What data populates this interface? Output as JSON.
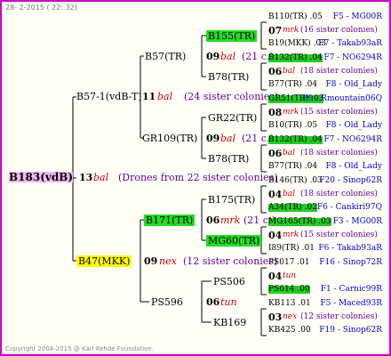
{
  "header": "28-  2-2015 ( 22: 32)",
  "footer": "Copyright 2004-2015 @ Karl Kehde Foundation.",
  "root": {
    "name": "B183(vdB)",
    "num": "13",
    "code": "bal",
    "note": "(Drones from 22 sister colonies)"
  },
  "gen1": [
    {
      "name": "B57-1(vdB-T)",
      "num": "11",
      "code": "bal",
      "note": "(24 sister colonies)"
    },
    {
      "name": "B47(MKK)",
      "num": "09",
      "code": "nex",
      "note": "(12 sister colonies)"
    }
  ],
  "gen2": [
    {
      "name": "B57(TR)",
      "num": "09",
      "code": "bal",
      "note": "(21 c.)"
    },
    {
      "name": "GR109(TR)",
      "num": "09",
      "code": "bal",
      "note": "(21 c.)"
    },
    {
      "name": "B171(TR)",
      "num": "06",
      "code": "mrk",
      "note": "(21 c.)"
    },
    {
      "name": "PS596",
      "num": "06",
      "code": "tun",
      "note": ""
    }
  ],
  "gen3": [
    {
      "name": "B155(TR)"
    },
    {
      "name": "B78(TR)"
    },
    {
      "name": "GR22(TR)"
    },
    {
      "name": "B78(TR)"
    },
    {
      "name": "B175(TR)"
    },
    {
      "name": "MG60(TR)"
    },
    {
      "name": "PS506"
    },
    {
      "name": "KB169"
    }
  ],
  "gen4": [
    {
      "a": "B110(TR) .05",
      "b": "F5 - MG00R"
    },
    {
      "num": "07",
      "code": "mrk",
      "note": "(16 sister colonies)"
    },
    {
      "a": "B19(MKK) .03",
      "b": "F7 - Takab93aR"
    },
    {
      "a": "B132(TR) .04",
      "b": "F7 - NO6294R"
    },
    {
      "num": "06",
      "code": "bal",
      "note": "(18 sister colonies)"
    },
    {
      "a": "B77(TR) .04",
      "b": "F8 - Old_Lady"
    },
    {
      "a": "GR51(TR) .03",
      "b": "F9 - Rmountain06Q"
    },
    {
      "num": "08",
      "code": "mrk",
      "note": "(15 sister colonies)"
    },
    {
      "a": "B10(TR) .05",
      "b": "F8 - Old_Lady"
    },
    {
      "a": "B132(TR) .04",
      "b": "F7 - NO6294R"
    },
    {
      "num": "06",
      "code": "bal",
      "note": "(18 sister colonies)"
    },
    {
      "a": "B77(TR) .04",
      "b": "F8 - Old_Lady"
    },
    {
      "a": "B146(TR) .03",
      "b": "F20 - Sinop62R"
    },
    {
      "num": "04",
      "code": "bal",
      "note": "(18 sister colonies)"
    },
    {
      "a": "A34(TR) .02",
      "b": "F6 - Cankiri97Q"
    },
    {
      "a": "MG165(TR) .03",
      "b": "F3 - MG00R"
    },
    {
      "num": "04",
      "code": "mrk",
      "note": "(15 sister colonies)"
    },
    {
      "a": "I89(TR) .01",
      "b": "F6 - Takab93aR"
    },
    {
      "a": "PS017 .01",
      "b": "F16 - Sinop72R"
    },
    {
      "num": "04",
      "code": "tun",
      "note": ""
    },
    {
      "a": "PS614 .00",
      "b": "F1 - Carnic99R"
    },
    {
      "a": "KB113 .01",
      "b": "F5 - Maced93R"
    },
    {
      "num": "03",
      "code": "nex",
      "note": "(12 sister colonies)"
    },
    {
      "a": "KB425 .00",
      "b": "F19 - Sinop62R"
    }
  ]
}
